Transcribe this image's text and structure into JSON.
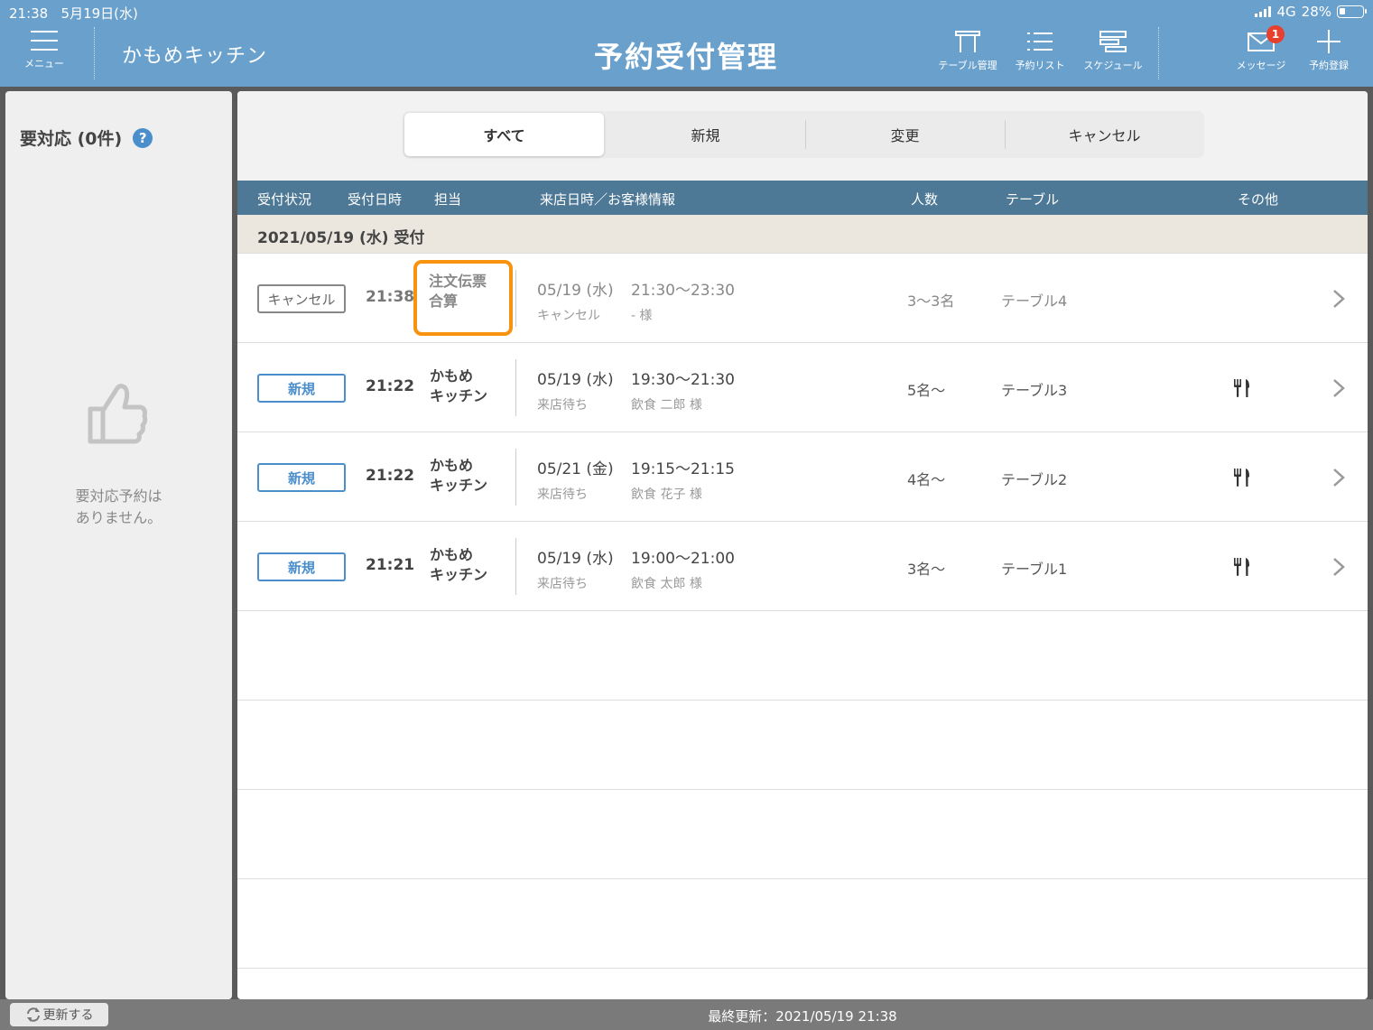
{
  "status_bar": {
    "time": "21:38",
    "date": "5月19日(水)",
    "network": "4G",
    "battery": "28%"
  },
  "header": {
    "menu_label": "メニュー",
    "shop_name": "かもめキッチン",
    "title": "予約受付管理",
    "nav": {
      "table_mgmt": "テーブル管理",
      "reservation_list": "予約リスト",
      "schedule": "スケジュール",
      "messages": "メッセージ",
      "messages_badge": "1",
      "new_reservation": "予約登録"
    }
  },
  "sidebar": {
    "title": "要対応 (0件)",
    "help": "?",
    "empty_line1": "要対応予約は",
    "empty_line2": "ありません。"
  },
  "tabs": [
    {
      "label": "すべて"
    },
    {
      "label": "新規"
    },
    {
      "label": "変更"
    },
    {
      "label": "キャンセル"
    }
  ],
  "columns": {
    "status": "受付状況",
    "received": "受付日時",
    "staff": "担当",
    "visit": "来店日時／お客様情報",
    "party": "人数",
    "table": "テーブル",
    "other": "その他"
  },
  "date_group": "2021/05/19 (水) 受付",
  "rows": [
    {
      "status": "キャンセル",
      "time": "21:38",
      "staff_line1": "注文伝票",
      "staff_line2": "合算",
      "visit_date": "05/19 (水)",
      "visit_time": "21:30〜23:30",
      "visit_status": "キャンセル",
      "customer": "- 様",
      "party": "3〜3名",
      "table": "テーブル4"
    },
    {
      "status": "新規",
      "time": "21:22",
      "staff_line1": "かもめ",
      "staff_line2": "キッチン",
      "visit_date": "05/19 (水)",
      "visit_time": "19:30〜21:30",
      "visit_status": "来店待ち",
      "customer": "飲食 二郎 様",
      "party": "5名〜",
      "table": "テーブル3"
    },
    {
      "status": "新規",
      "time": "21:22",
      "staff_line1": "かもめ",
      "staff_line2": "キッチン",
      "visit_date": "05/21 (金)",
      "visit_time": "19:15〜21:15",
      "visit_status": "来店待ち",
      "customer": "飲食 花子 様",
      "party": "4名〜",
      "table": "テーブル2"
    },
    {
      "status": "新規",
      "time": "21:21",
      "staff_line1": "かもめ",
      "staff_line2": "キッチン",
      "visit_date": "05/19 (水)",
      "visit_time": "19:00〜21:00",
      "visit_status": "来店待ち",
      "customer": "飲食 太郎 様",
      "party": "3名〜",
      "table": "テーブル1"
    }
  ],
  "footer": {
    "refresh_label": "更新する",
    "last_update": "最終更新：2021/05/19 21:38"
  }
}
